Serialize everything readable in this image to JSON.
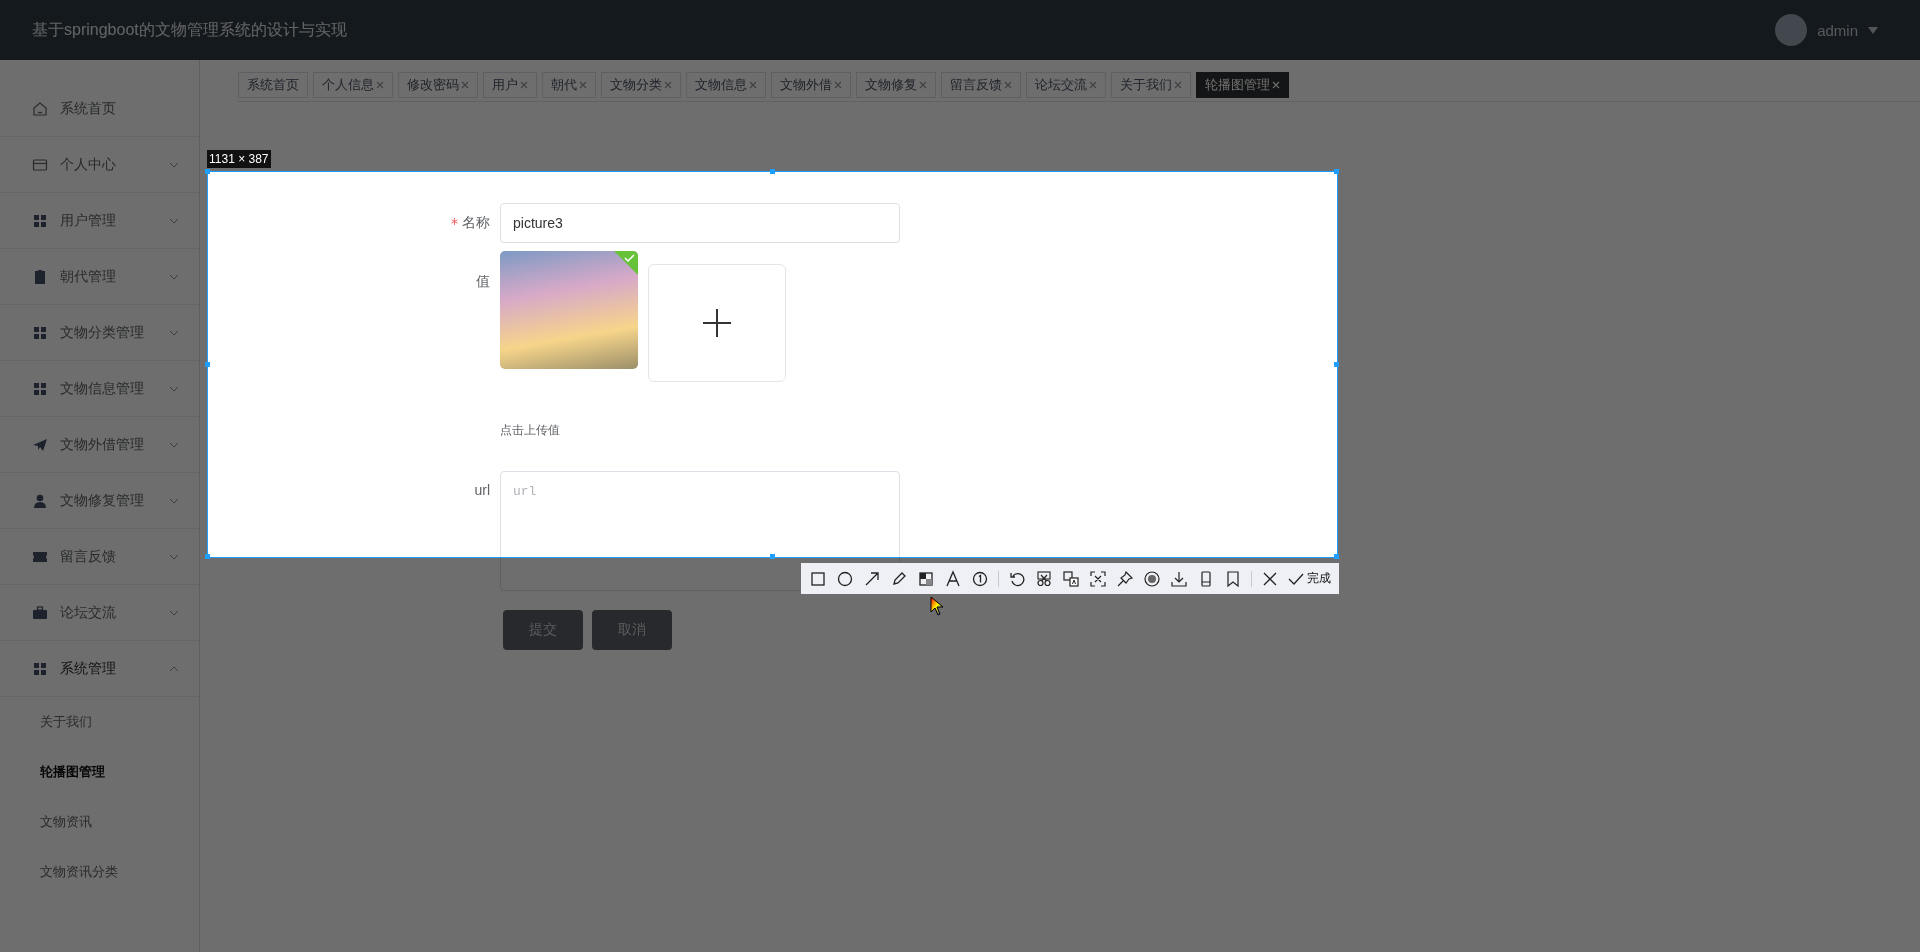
{
  "header": {
    "title": "基于springboot的文物管理系统的设计与实现",
    "user": "admin"
  },
  "sidebar": {
    "items": [
      {
        "label": "系统首页",
        "kind": "link",
        "expanded": false
      },
      {
        "label": "个人中心",
        "kind": "menu",
        "expanded": false
      },
      {
        "label": "用户管理",
        "kind": "menu",
        "expanded": false
      },
      {
        "label": "朝代管理",
        "kind": "menu",
        "expanded": false
      },
      {
        "label": "文物分类管理",
        "kind": "menu",
        "expanded": false
      },
      {
        "label": "文物信息管理",
        "kind": "menu",
        "expanded": false
      },
      {
        "label": "文物外借管理",
        "kind": "menu",
        "expanded": false
      },
      {
        "label": "文物修复管理",
        "kind": "menu",
        "expanded": false
      },
      {
        "label": "留言反馈",
        "kind": "menu",
        "expanded": false
      },
      {
        "label": "论坛交流",
        "kind": "menu",
        "expanded": false
      },
      {
        "label": "系统管理",
        "kind": "menu",
        "expanded": true,
        "children": [
          {
            "label": "关于我们",
            "selected": false
          },
          {
            "label": "轮播图管理",
            "selected": true
          },
          {
            "label": "文物资讯",
            "selected": false
          },
          {
            "label": "文物资讯分类",
            "selected": false
          }
        ]
      }
    ]
  },
  "tabs": [
    {
      "label": "系统首页",
      "closable": false,
      "selected": false
    },
    {
      "label": "个人信息",
      "closable": true,
      "selected": false
    },
    {
      "label": "修改密码",
      "closable": true,
      "selected": false
    },
    {
      "label": "用户",
      "closable": true,
      "selected": false
    },
    {
      "label": "朝代",
      "closable": true,
      "selected": false
    },
    {
      "label": "文物分类",
      "closable": true,
      "selected": false
    },
    {
      "label": "文物信息",
      "closable": true,
      "selected": false
    },
    {
      "label": "文物外借",
      "closable": true,
      "selected": false
    },
    {
      "label": "文物修复",
      "closable": true,
      "selected": false
    },
    {
      "label": "留言反馈",
      "closable": true,
      "selected": false
    },
    {
      "label": "论坛交流",
      "closable": true,
      "selected": false
    },
    {
      "label": "关于我们",
      "closable": true,
      "selected": false
    },
    {
      "label": "轮播图管理",
      "closable": true,
      "selected": true
    }
  ],
  "form": {
    "fields": [
      {
        "kind": "text",
        "label": "名称",
        "required": true,
        "value": "picture3"
      },
      {
        "kind": "upload",
        "label": "值",
        "required": false,
        "hint": "点击上传值"
      },
      {
        "kind": "textarea",
        "label": "url",
        "required": false,
        "placeholder": "url"
      }
    ],
    "buttons": [
      "提交",
      "取消"
    ]
  },
  "capture": {
    "size_label": "1131 × 387",
    "done": "完成"
  }
}
